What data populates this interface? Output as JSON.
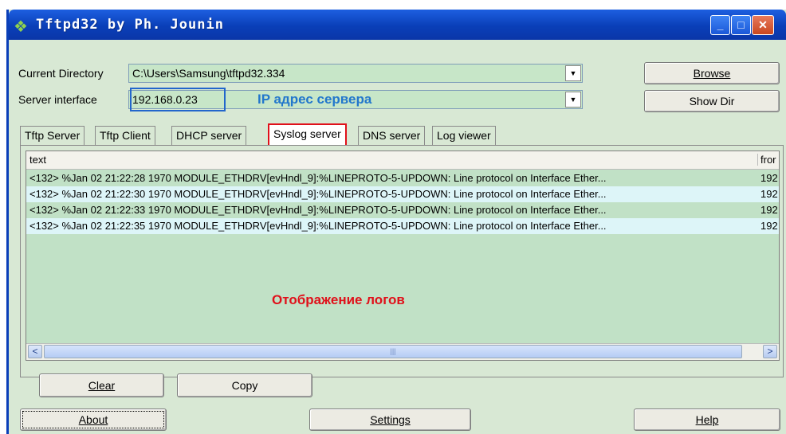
{
  "window": {
    "title": "Tftpd32 by Ph. Jounin"
  },
  "controls": {
    "current_directory_label": "Current Directory",
    "current_directory_value": "C:\\Users\\Samsung\\tftpd32.334",
    "server_interface_label": "Server interface",
    "server_interface_value": "192.168.0.23",
    "browse_button": "Browse",
    "showdir_button": "Show Dir"
  },
  "annotations": {
    "ip_note": "IP адрес сервера",
    "log_note": "Отображение логов"
  },
  "tabs": [
    "Tftp Server",
    "Tftp Client",
    "DHCP server",
    "Syslog server",
    "DNS server",
    "Log viewer"
  ],
  "active_tab": "Syslog server",
  "log_table": {
    "columns": [
      "text",
      "fror"
    ],
    "rows": [
      {
        "text": "<132> %Jan 02 21:22:28 1970 MODULE_ETHDRV[evHndl_9]:%LINEPROTO-5-UPDOWN: Line protocol on Interface Ether...",
        "from": "192"
      },
      {
        "text": "<132> %Jan 02 21:22:30 1970 MODULE_ETHDRV[evHndl_9]:%LINEPROTO-5-UPDOWN: Line protocol on Interface Ether...",
        "from": "192"
      },
      {
        "text": "<132> %Jan 02 21:22:33 1970 MODULE_ETHDRV[evHndl_9]:%LINEPROTO-5-UPDOWN: Line protocol on Interface Ether...",
        "from": "192"
      },
      {
        "text": "<132> %Jan 02 21:22:35 1970 MODULE_ETHDRV[evHndl_9]:%LINEPROTO-5-UPDOWN: Line protocol on Interface Ether...",
        "from": "192"
      }
    ]
  },
  "panel_buttons": {
    "clear": "Clear",
    "copy": "Copy"
  },
  "footer_buttons": {
    "about": "About",
    "settings": "Settings",
    "help": "Help"
  },
  "icons": {
    "app": "tftp-app-icon",
    "minimize": "minimize-icon",
    "maximize": "maximize-icon",
    "close": "close-icon"
  },
  "colors": {
    "title_bar": "#0a3fb8",
    "window_bg": "#d8e8d4",
    "ip_annotation": "#2277cc",
    "highlight_red": "#e0101a"
  }
}
